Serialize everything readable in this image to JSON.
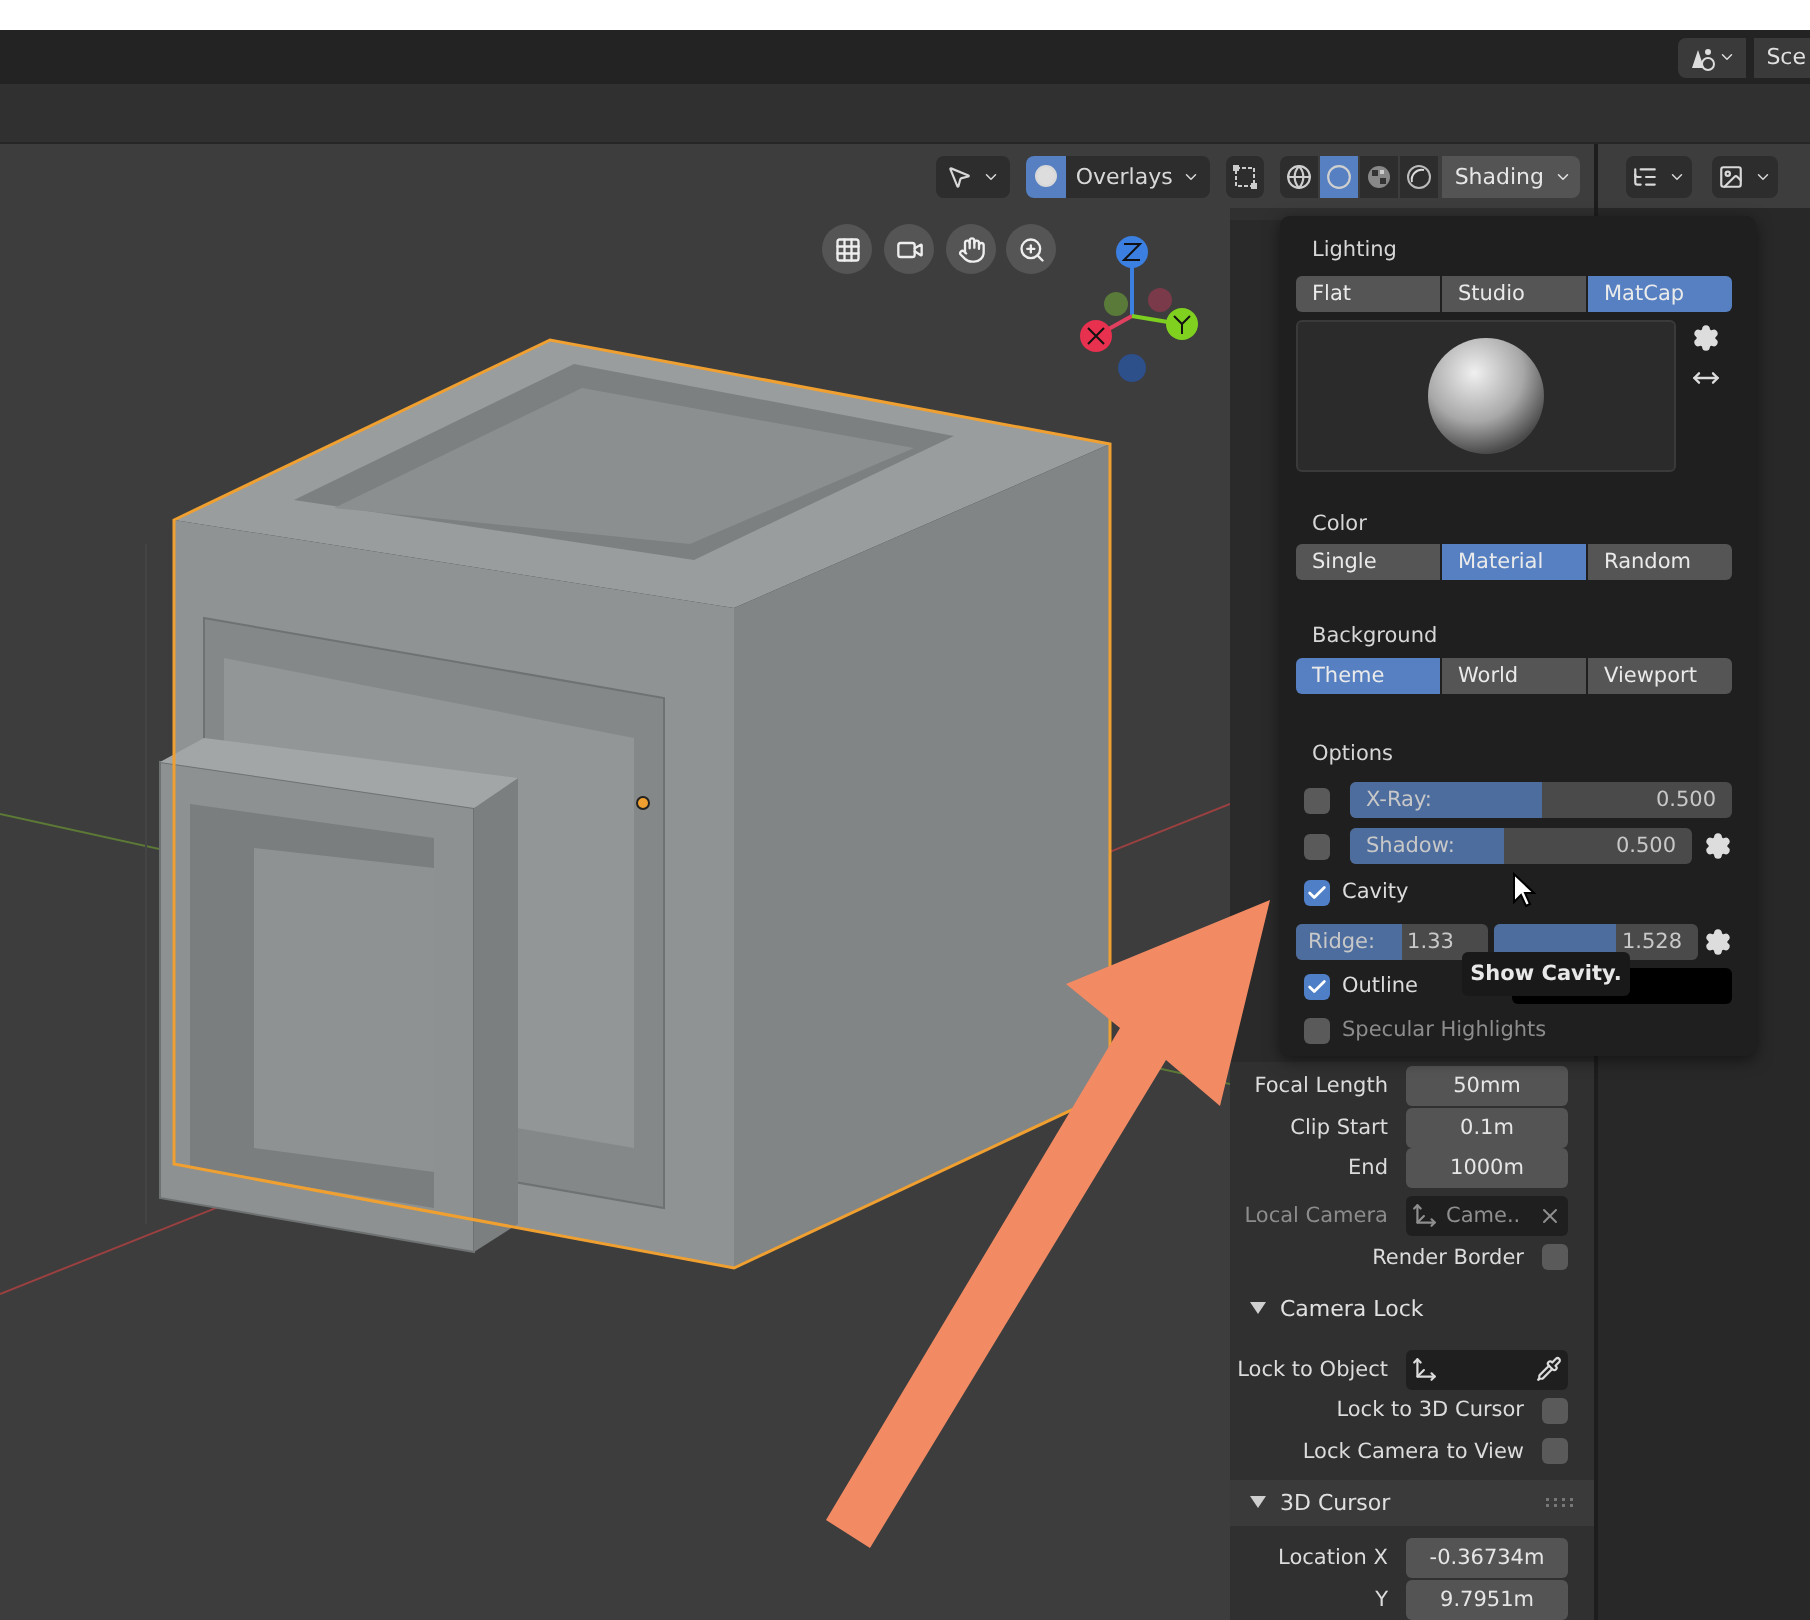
{
  "top_bar": {
    "scene_label": "Sce"
  },
  "viewport_header": {
    "overlays_label": "Overlays",
    "shading_label": "Shading",
    "shading_modes": [
      {
        "kind": "wireframe",
        "selected": false
      },
      {
        "kind": "solid",
        "selected": true
      },
      {
        "kind": "material",
        "selected": false
      },
      {
        "kind": "rendered",
        "selected": false
      }
    ]
  },
  "shading_popover": {
    "lighting": {
      "title": "Lighting",
      "options": [
        {
          "label": "Flat",
          "selected": false
        },
        {
          "label": "Studio",
          "selected": false
        },
        {
          "label": "MatCap",
          "selected": true
        }
      ]
    },
    "color": {
      "title": "Color",
      "options": [
        {
          "label": "Single",
          "selected": false
        },
        {
          "label": "Material",
          "selected": true
        },
        {
          "label": "Random",
          "selected": false
        }
      ]
    },
    "background": {
      "title": "Background",
      "options": [
        {
          "label": "Theme",
          "selected": true
        },
        {
          "label": "World",
          "selected": false
        },
        {
          "label": "Viewport",
          "selected": false
        }
      ]
    },
    "options_title": "Options",
    "options": [
      {
        "kind": "slider",
        "checked": false,
        "label": "X-Ray:",
        "value": "0.500",
        "level": 0.5,
        "gear": false
      },
      {
        "kind": "slider",
        "checked": false,
        "label": "Shadow:",
        "value": "0.500",
        "level": 0.45,
        "gear": true
      },
      {
        "kind": "check",
        "checked": true,
        "label": "Cavity"
      },
      {
        "kind": "pair",
        "ridge": {
          "label": "Ridge:",
          "value": "1.33",
          "level": 0.55
        },
        "valley": {
          "value": "1.528",
          "level": 0.6
        }
      },
      {
        "kind": "color",
        "checked": true,
        "label": "Outline"
      },
      {
        "kind": "check",
        "checked": false,
        "label": "Specular Highlights"
      }
    ]
  },
  "tooltip": "Show Cavity.",
  "sidebar": {
    "rows": [
      {
        "kind": "field",
        "label": "Focal Length",
        "value": "50mm"
      },
      {
        "kind": "field",
        "label": "Clip Start",
        "value": "0.1m"
      },
      {
        "kind": "field",
        "label": "End",
        "value": "1000m"
      },
      {
        "kind": "object",
        "label": "Local Camera",
        "value": "Came..",
        "clearable": true,
        "disabled": true
      },
      {
        "kind": "check",
        "label": "Render Border",
        "checked": false
      },
      {
        "kind": "header",
        "label": "Camera Lock",
        "expanded": true
      },
      {
        "kind": "object",
        "label": "Lock to Object",
        "clearable": false,
        "disabled": false
      },
      {
        "kind": "check",
        "label": "Lock to 3D Cursor",
        "checked": false
      },
      {
        "kind": "check",
        "label": "Lock Camera to View",
        "checked": false
      },
      {
        "kind": "header",
        "label": "3D Cursor",
        "expanded": true
      },
      {
        "kind": "field",
        "label": "Location X",
        "value": "-0.36734m"
      },
      {
        "kind": "field",
        "label": "Y",
        "value": "9.7951m"
      }
    ]
  }
}
